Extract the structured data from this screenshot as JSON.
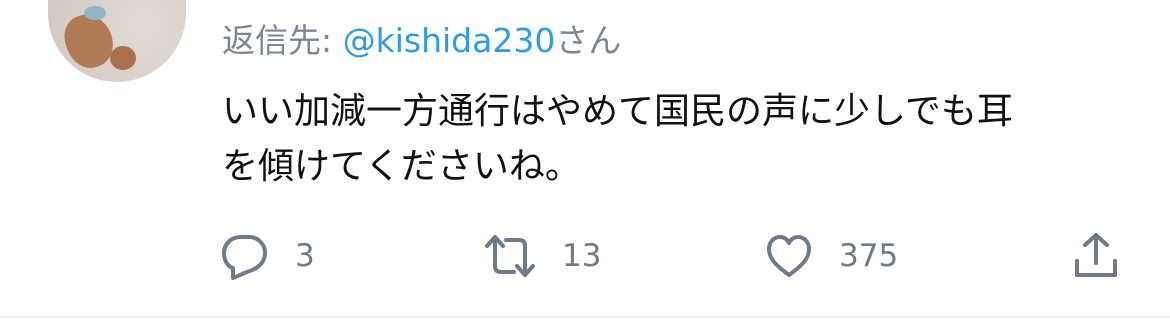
{
  "tweet": {
    "reply_prefix": "返信先: ",
    "reply_handle": "@kishida230",
    "reply_suffix": "さん",
    "text_lines": [
      "いい加減一方通行はやめて国民の声に少しでも耳",
      "を傾けてくださいね。"
    ]
  },
  "actions": {
    "reply": {
      "icon": "reply-icon",
      "count": "3"
    },
    "retweet": {
      "icon": "retweet-icon",
      "count": "13"
    },
    "like": {
      "icon": "heart-icon",
      "count": "375"
    },
    "share": {
      "icon": "share-icon"
    }
  },
  "colors": {
    "handle": "#2f9be6",
    "muted": "#7b8791",
    "text": "#111111"
  }
}
